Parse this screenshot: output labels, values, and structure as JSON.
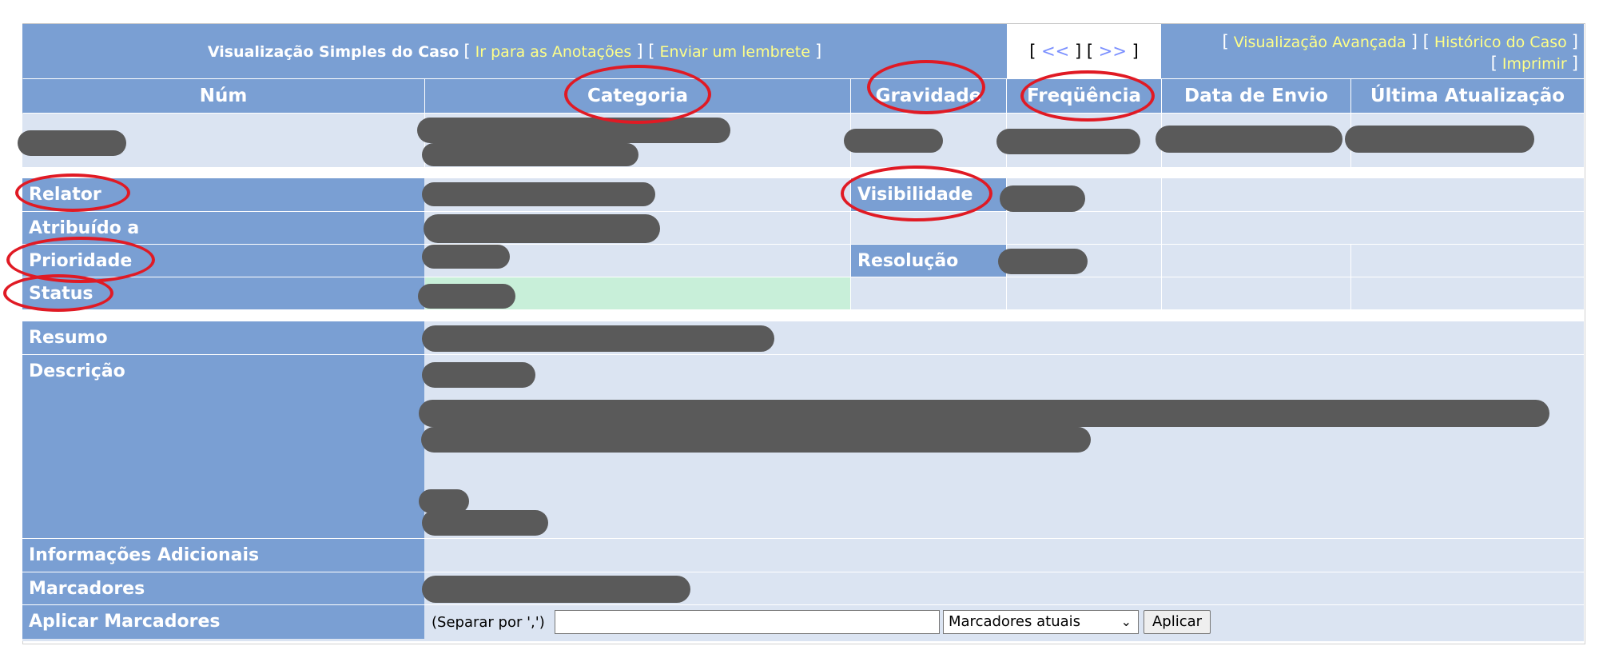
{
  "header": {
    "title": "Visualização Simples do Caso",
    "links_left": [
      "Ir para as Anotações",
      "Enviar um lembrete"
    ],
    "nav_prev": "<<",
    "nav_next": ">>",
    "links_right": [
      "Visualização Avançada",
      "Histórico do Caso",
      "Imprimir"
    ]
  },
  "columns": [
    "Núm",
    "Categoria",
    "Gravidade",
    "Freqüência",
    "Data de Envio",
    "Última Atualização"
  ],
  "fields": {
    "relator": "Relator",
    "visibilidade": "Visibilidade",
    "atribuido": "Atribuído a",
    "prioridade": "Prioridade",
    "resolucao": "Resolução",
    "status": "Status",
    "resumo": "Resumo",
    "descricao": "Descrição",
    "info_adicionais": "Informações Adicionais",
    "marcadores": "Marcadores",
    "aplicar_marcadores": "Aplicar Marcadores"
  },
  "tag_form": {
    "hint": "(Separar por ',')",
    "input_value": "",
    "select_value": "Marcadores atuais",
    "apply_label": "Aplicar"
  },
  "colors": {
    "header_blue": "#7a9fd3",
    "row_light": "#dbe4f2",
    "status_green": "#c8efd9",
    "link_yellow": "#ffff88",
    "annotation_red": "#e01a24",
    "redaction_gray": "#5a5a5a"
  }
}
